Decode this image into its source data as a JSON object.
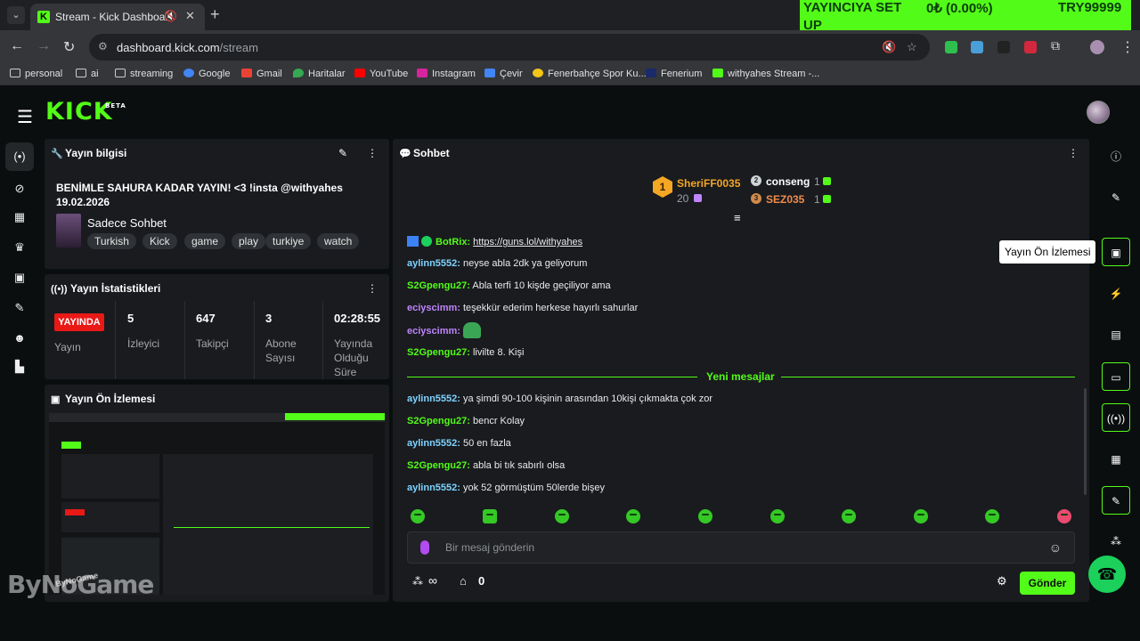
{
  "browser": {
    "tab_title": "Stream - Kick Dashboard",
    "tab_menu_icon": "chevron-down-icon",
    "new_tab_icon": "plus-icon",
    "ticker": [
      "YAYINCIYA SET",
      "0₺ (0.00%)",
      "TRY99999",
      "UP"
    ],
    "url_host": "dashboard.kick.com",
    "url_path": "/stream",
    "bookmarks": [
      "personal",
      "ai",
      "streaming",
      "Google",
      "Gmail",
      "Haritalar",
      "YouTube",
      "Instagram",
      "Çevir",
      "Fenerbahçe Spor Ku...",
      "Fenerium",
      "withyahes Stream -..."
    ]
  },
  "app": {
    "logo": "KICK",
    "logo_badge": "BETA"
  },
  "stream_info": {
    "header": "Yayın bilgisi",
    "title_line1": "BENİMLE SAHURA KADAR YAYIN! <3 !insta @withyahes",
    "title_line2": "19.02.2026",
    "category": "Sadece Sohbet",
    "tags": [
      "Turkish",
      "Kick",
      "game",
      "play",
      "turkiye",
      "watch"
    ]
  },
  "stats": {
    "header": "Yayın İstatistikleri",
    "live_label": "YAYINDA",
    "live_sub": "Yayın",
    "viewers_value": "5",
    "viewers_label": "İzleyici",
    "followers_value": "647",
    "followers_label": "Takipçi",
    "subs_value": "3",
    "subs_label": "Abone Sayısı",
    "duration_value": "02:28:55",
    "duration_label": "Yayında Olduğu Süre"
  },
  "preview": {
    "header": "Yayın Ön İzlemesi"
  },
  "chat": {
    "header": "Sohbet",
    "leaderboard": {
      "first_name": "SheriFF0035",
      "first_count": "20",
      "first_rank": "1",
      "second_name": "conseng",
      "second_count": "1",
      "second_rank": "2",
      "third_name": "SEZ035",
      "third_count": "1",
      "third_rank": "3"
    },
    "messages": [
      {
        "user": "BotRix:",
        "text": "https://guns.lol/withyahes",
        "color": "#53fc18"
      },
      {
        "user": "aylinn5552:",
        "text": "neyse abla 2dk ya geliyorum",
        "color": "#7fd3ff"
      },
      {
        "user": "S2Gpengu27:",
        "text": "Abla terfi 10 kişde geçiliyor ama",
        "color": "#53fc18"
      },
      {
        "user": "eciyscimm:",
        "text": "teşekkür ederim herkese hayırlı sahurlar",
        "color": "#c084fc"
      },
      {
        "user": "eciyscimm:",
        "text": "",
        "color": "#c084fc"
      },
      {
        "user": "S2Gpengu27:",
        "text": "livilte 8. Kişi",
        "color": "#53fc18"
      }
    ],
    "new_messages_label": "Yeni mesajlar",
    "new_messages": [
      {
        "user": "aylinn5552:",
        "text": "ya şimdi 90-100 kişinin arasından 10kişi çıkmakta çok zor",
        "color": "#7fd3ff"
      },
      {
        "user": "S2Gpengu27:",
        "text": "bencr Kolay",
        "color": "#53fc18"
      },
      {
        "user": "aylinn5552:",
        "text": "50 en fazla",
        "color": "#7fd3ff"
      },
      {
        "user": "S2Gpengu27:",
        "text": "abla bi tık sabırlı olsa",
        "color": "#53fc18"
      },
      {
        "user": "aylinn5552:",
        "text": "yok 52 görmüştüm 50lerde bişey",
        "color": "#7fd3ff"
      }
    ],
    "input_placeholder": "Bir mesaj gönderin",
    "points_value": "∞",
    "store_value": "0",
    "send_label": "Gönder"
  },
  "tooltip": "Yayın Ön İzlemesi",
  "watermark": "ByNoGame",
  "watermark_small": "ByNoGame",
  "colors": {
    "accent": "#53fc18",
    "live": "#e91916",
    "panel": "#191b1f"
  }
}
